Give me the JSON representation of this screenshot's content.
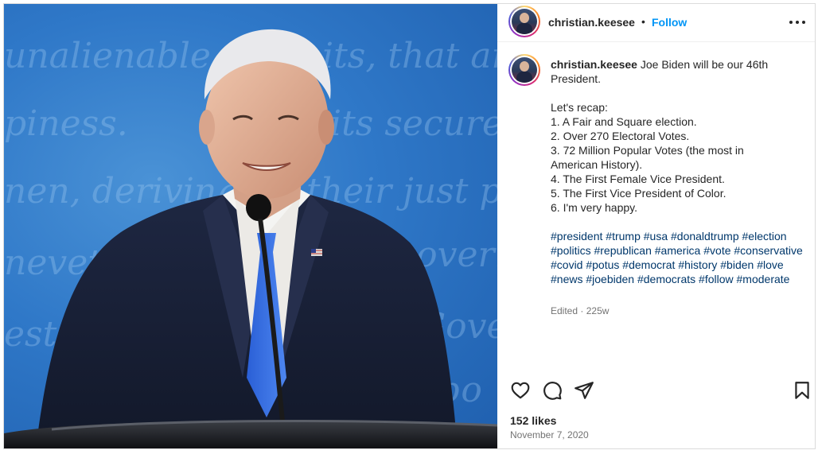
{
  "post": {
    "image": {
      "subject": "Joe Biden at a debate podium in front of a blue backdrop",
      "backdrop_script": [
        "unalienable",
        "its, that am",
        "piness.",
        "its secure",
        "nen, deriving",
        "their just pow",
        "governm",
        "nevet",
        "Gover",
        "est fo",
        "abo"
      ],
      "background_color": "#2f78c8"
    },
    "header": {
      "username": "christian.keesee",
      "separator": "•",
      "follow_label": "Follow",
      "more_icon": "more-horizontal-icon"
    },
    "caption": {
      "username": "christian.keesee",
      "text": " Joe Biden will be our 46th\nPresident.\n\nLet's recap:\n1. A Fair and Square election.\n2. Over 270 Electoral Votes.\n3. 72 Million Popular Votes (the most in\nAmerican History).\n4. The First Female Vice President.\n5. The First Vice President of Color.\n6. I'm very happy.",
      "hashtags": [
        "#president",
        "#trump",
        "#usa",
        "#donaldtrump",
        "#election",
        "#politics",
        "#republican",
        "#america",
        "#vote",
        "#conservative",
        "#covid",
        "#potus",
        "#democrat",
        "#history",
        "#biden",
        "#love",
        "#news",
        "#joebiden",
        "#democrats",
        "#follow",
        "#moderate"
      ],
      "edited_label": "Edited",
      "meta_separator": "·",
      "age": "225w"
    },
    "actions": {
      "like_icon": "heart-icon",
      "comment_icon": "comment-icon",
      "share_icon": "share-icon",
      "save_icon": "bookmark-icon"
    },
    "likes": "152 likes",
    "date": "November 7, 2020"
  },
  "colors": {
    "link": "#0095f6",
    "hashtag": "#00376b",
    "muted": "#737373",
    "text": "#262626"
  }
}
